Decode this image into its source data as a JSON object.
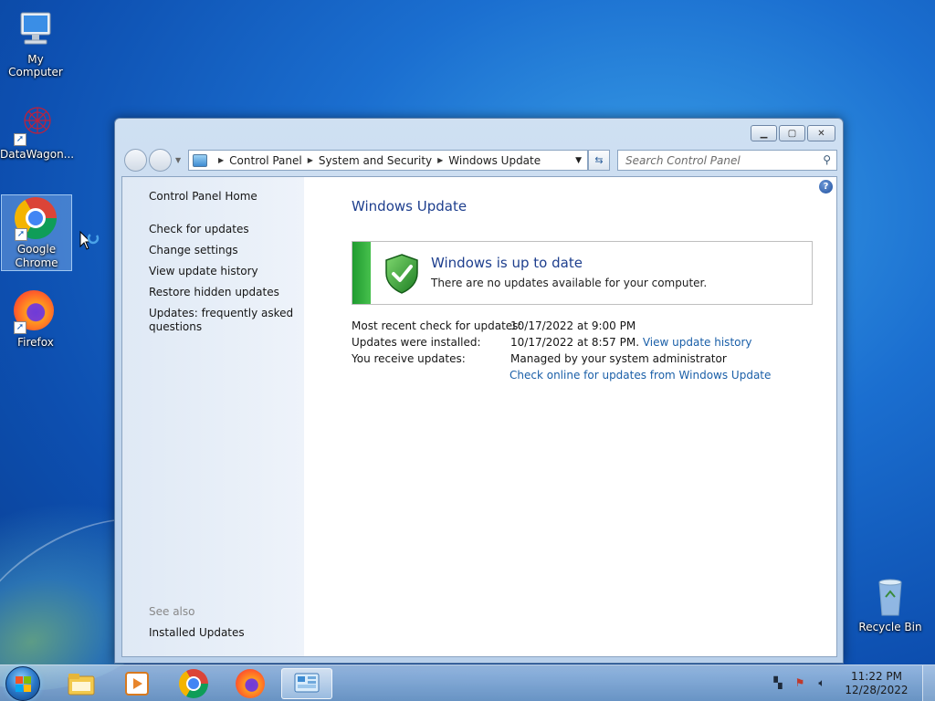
{
  "desktop": {
    "icons": [
      {
        "label": "My Computer",
        "icon": "computer-icon"
      },
      {
        "label": "DataWagon...",
        "icon": "datawagon-icon"
      },
      {
        "label": "Google Chrome",
        "icon": "chrome-icon"
      },
      {
        "label": "Firefox",
        "icon": "firefox-icon"
      },
      {
        "label": "Recycle Bin",
        "icon": "recycle-bin-icon"
      }
    ]
  },
  "window": {
    "address": {
      "crumbs": [
        "Control Panel",
        "System and Security",
        "Windows Update"
      ]
    },
    "search": {
      "placeholder": "Search Control Panel"
    },
    "sidebar": {
      "home": "Control Panel Home",
      "links": [
        "Check for updates",
        "Change settings",
        "View update history",
        "Restore hidden updates",
        "Updates: frequently asked questions"
      ],
      "see_also_label": "See also",
      "see_also_links": [
        "Installed Updates"
      ]
    },
    "main": {
      "title": "Windows Update",
      "status": {
        "title": "Windows is up to date",
        "subtitle": "There are no updates available for your computer.",
        "color": "#2ea43a"
      },
      "info": {
        "recent_check_label": "Most recent check for updates:",
        "recent_check_value": "10/17/2022 at 9:00 PM",
        "installed_label": "Updates were installed:",
        "installed_value": "10/17/2022 at 8:57 PM.",
        "installed_link": "View update history",
        "receive_label": "You receive updates:",
        "receive_value": "Managed by your system administrator",
        "online_link": "Check online for updates from Windows Update"
      }
    }
  },
  "taskbar": {
    "items": [
      "windows-explorer-icon",
      "media-player-icon",
      "chrome-icon",
      "firefox-icon",
      "control-panel-icon"
    ],
    "clock": {
      "time": "11:22 PM",
      "date": "12/28/2022"
    }
  }
}
